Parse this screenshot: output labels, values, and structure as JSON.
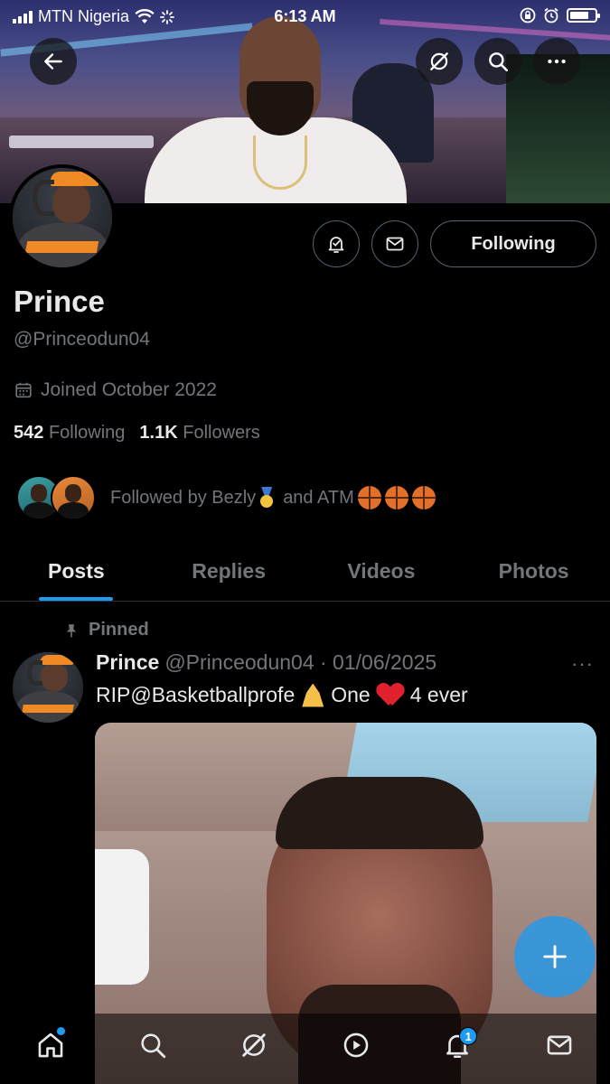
{
  "status_bar": {
    "carrier": "MTN Nigeria",
    "time": "6:13 AM"
  },
  "header": {
    "back_icon": "arrow-left-icon",
    "grok_icon": "grok-icon",
    "search_icon": "search-icon",
    "more_icon": "more-horizontal-icon"
  },
  "profile": {
    "name": "Prince",
    "handle": "@Princeodun04",
    "joined": "Joined October 2022",
    "following_count": "542",
    "following_label": "Following",
    "followers_count": "1.1K",
    "followers_label": "Followers",
    "followed_by_prefix": "Followed by Bezly",
    "followed_by_middle": "and ATM",
    "follow_button": "Following"
  },
  "tabs": [
    {
      "label": "Posts",
      "active": true
    },
    {
      "label": "Replies",
      "active": false
    },
    {
      "label": "Videos",
      "active": false
    },
    {
      "label": "Photos",
      "active": false
    }
  ],
  "post": {
    "pinned_label": "Pinned",
    "author_name": "Prince",
    "author_handle_date": "@Princeodun04 · 01/06/2025",
    "text_start": "RIP@Basketballprofe",
    "text_mid": "One",
    "text_end": "4 ever",
    "more": "···"
  },
  "bottom_nav": {
    "notifications_badge": "1",
    "items": [
      "home-icon",
      "search-icon",
      "grok-icon",
      "video-play-icon",
      "notifications-icon",
      "messages-icon"
    ]
  },
  "colors": {
    "accent": "#1d9bf0",
    "secondary_text": "#71767b",
    "primary_text": "#e7e9ea",
    "border": "#2f3336"
  }
}
